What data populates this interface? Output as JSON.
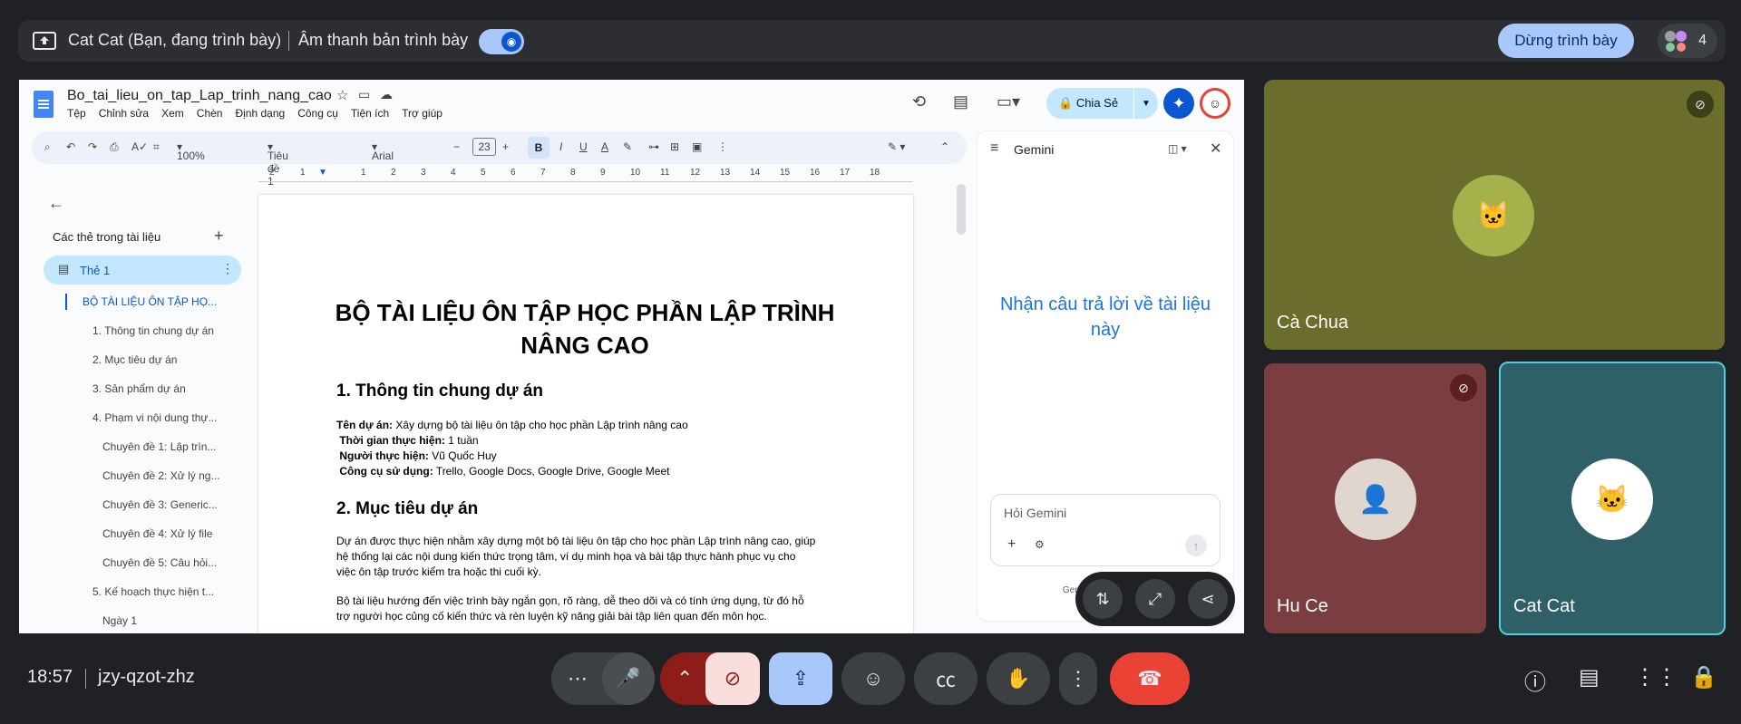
{
  "banner": {
    "title": "Cat Cat (Bạn, đang trình bày)",
    "audio_label": "Âm thanh bản trình bày",
    "stop_label": "Dừng trình bày",
    "participant_count": "4"
  },
  "doc": {
    "file_name": "Bo_tai_lieu_on_tap_Lap_trinh_nang_cao",
    "menu": [
      "Tệp",
      "Chỉnh sửa",
      "Xem",
      "Chèn",
      "Định dạng",
      "Công cụ",
      "Tiện ích",
      "Trợ giúp"
    ],
    "share_label": "Chia Sẻ",
    "toolbar": {
      "zoom": "100%",
      "style": "Tiêu đề 1",
      "font": "Arial",
      "font_size": "23"
    },
    "ruler_ticks": [
      "2",
      "1",
      "1",
      "2",
      "3",
      "4",
      "5",
      "6",
      "7",
      "8",
      "9",
      "10",
      "11",
      "12",
      "13",
      "14",
      "15",
      "16",
      "17",
      "18"
    ],
    "outline": {
      "header": "Các thẻ trong tài liệu",
      "tab1": "Thẻ 1",
      "items": [
        "BỘ TÀI LIỆU ÔN TẬP HỌ...",
        "1. Thông tin chung dự án",
        "2. Mục tiêu dự án",
        "3. Sản phẩm dự án",
        "4. Phạm vi nội dung thự...",
        "Chuyên đề 1: Lập trìn...",
        "Chuyên đề 2: Xử lý ng...",
        "Chuyên đề 3: Generic...",
        "Chuyên đề 4: Xử lý file",
        "Chuyên đề 5: Câu hỏi...",
        "5. Kế hoạch thực hiện t...",
        "Ngày 1"
      ]
    },
    "page": {
      "title": "BỘ TÀI LIỆU ÔN TẬP HỌC PHẦN LẬP TRÌNH NÂNG CAO",
      "h1_a": "1. Thông tin chung dự án",
      "info": [
        {
          "k": "Tên dự án:",
          "v": " Xây dựng bộ tài liệu ôn tập cho học phần Lập trình nâng cao"
        },
        {
          "k": "Thời gian thực hiện:",
          "v": " 1 tuần"
        },
        {
          "k": "Người thực hiện:",
          "v": " Vũ Quốc Huy"
        },
        {
          "k": "Công cụ sử dụng:",
          "v": " Trello, Google Docs, Google Drive, Google Meet"
        }
      ],
      "h1_b": "2. Mục tiêu dự án",
      "para1": "Dự án được thực hiện nhằm xây dựng một bộ tài liệu ôn tập cho học phần Lập trình nâng cao, giúp hệ thống lại các nội dung kiến thức trọng tâm, ví dụ minh họa và bài tập thực hành phục vụ cho việc ôn tập trước kiểm tra hoặc thi cuối kỳ.",
      "para2": "Bộ tài liệu hướng đến việc trình bày ngắn gọn, rõ ràng, dễ theo dõi và có tính ứng dụng, từ đó hỗ trợ người học củng cố kiến thức và rèn luyện kỹ năng giải bài tập liên quan đến môn học."
    },
    "gemini": {
      "title": "Gemini",
      "cta": "Nhận câu trả lời về tài liệu này",
      "input_placeholder": "Hỏi Gemini",
      "disclaimer": "Gemini ... thể mắc ..."
    }
  },
  "tiles": [
    {
      "name": "Cà Chua",
      "muted": true
    },
    {
      "name": "Hu Ce",
      "muted": true
    },
    {
      "name": "Cat Cat",
      "muted": false
    }
  ],
  "bottom": {
    "time": "18:57",
    "meeting_code": "jzy-qzot-zhz"
  },
  "colors": {
    "end_call": "#ea4335",
    "camera_off": "#f9dedc",
    "present_active": "#a8c7fa",
    "tile_1": "#6b6d2c",
    "tile_2": "#7a3d40",
    "tile_3": "#2f6068"
  }
}
